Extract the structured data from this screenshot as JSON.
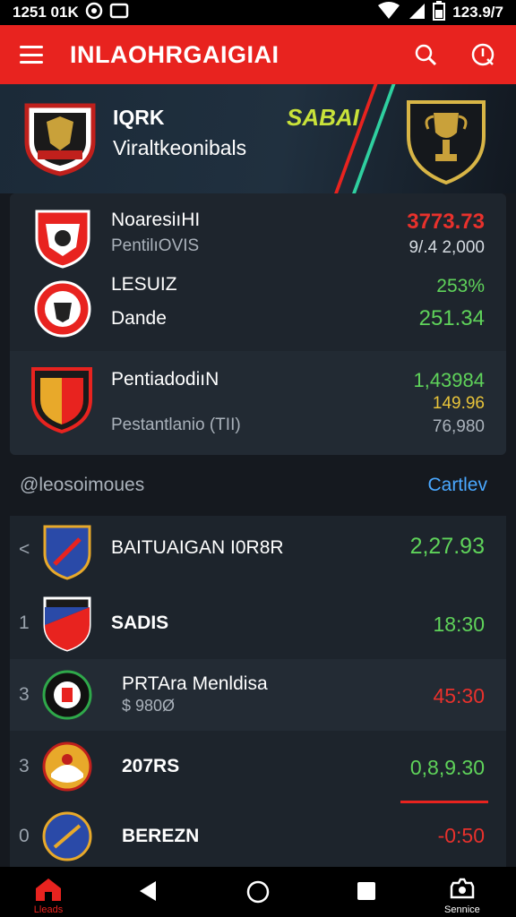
{
  "status_bar": {
    "time": "1251 01K",
    "battery": "123.9/7"
  },
  "app_bar": {
    "title": "INLAOHRGAIGIAI"
  },
  "hero": {
    "line1": "IQRK",
    "line2": "Viraltkeonibals",
    "tag": "SABAI"
  },
  "featured": [
    {
      "name": "NoaresiıHI",
      "sub": "PentilıOVIS",
      "value": "3773.73",
      "value_sub": "9/.4 2,000",
      "value_color": "#e8312c"
    },
    {
      "name": "LESUIZ",
      "sub": "Dande",
      "value": "253%",
      "value_sub": "251.34",
      "value_color": "#5fd35a"
    },
    {
      "name": "PentiadodiıN",
      "sub": "Pestantlanio (TII)",
      "value": "1,43984",
      "value_mid": "149.96",
      "value_sub": "76,980",
      "value_color": "#5fd35a"
    }
  ],
  "section": {
    "title": "@leosoimoues",
    "action": "Cartlev"
  },
  "list": [
    {
      "rank": "<",
      "name": "BAITUAIGAN I0R8R",
      "sub": "",
      "value": "2,27.93",
      "value_color": "#5fd35a"
    },
    {
      "rank": "1",
      "name": "SADIS",
      "sub": "",
      "value": "18:30",
      "value_color": "#5fd35a"
    },
    {
      "rank": "3",
      "name": "PRTArа Menldisa",
      "sub": "$ 980Ø",
      "value": "45:30",
      "value_color": "#e8312c"
    },
    {
      "rank": "3",
      "name": "207RS",
      "sub": "",
      "value": "0,8,9.30",
      "value_color": "#5fd35a"
    },
    {
      "rank": "0",
      "name": "BEREZN",
      "sub": "",
      "value": "-0:50",
      "value_color": "#e8312c"
    }
  ],
  "nav": {
    "home_label": "Lleads",
    "settings_label": "Sennice"
  },
  "colors": {
    "brand_red": "#e8231f",
    "positive": "#5fd35a",
    "negative": "#e8312c",
    "accent_blue": "#4aa8ff"
  }
}
